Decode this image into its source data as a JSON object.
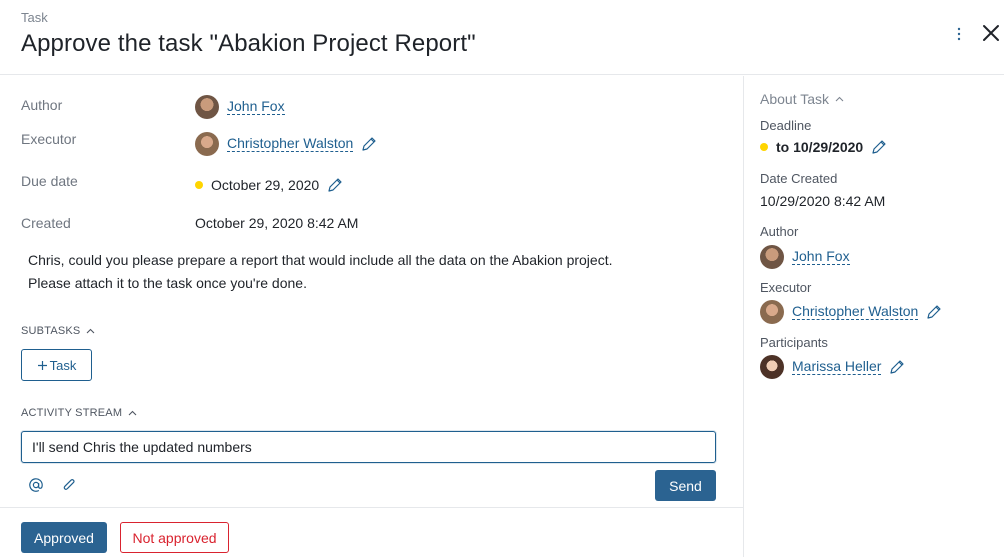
{
  "header": {
    "kind": "Task",
    "title": "Approve the task \"Abakion Project Report\""
  },
  "details": {
    "author_label": "Author",
    "author_name": "John Fox",
    "executor_label": "Executor",
    "executor_name": "Christopher Walston",
    "due_label": "Due date",
    "due_value": "October 29, 2020",
    "created_label": "Created",
    "created_value": "October 29, 2020 8:42 AM"
  },
  "description": {
    "line1": "Chris, could you please prepare a report that would include all the data on the Abakion project.",
    "line2": "Please attach it to the task once you're done."
  },
  "subtasks": {
    "title": "SUBTASKS",
    "add_label": "Task"
  },
  "activity": {
    "title": "ACTIVITY STREAM",
    "input_value": "I'll send Chris the updated numbers",
    "send_label": "Send"
  },
  "actions": {
    "approved_label": "Approved",
    "not_approved_label": "Not approved"
  },
  "sidebar": {
    "title": "About Task",
    "deadline_label": "Deadline",
    "deadline_value": "to 10/29/2020",
    "date_created_label": "Date Created",
    "date_created_value": "10/29/2020 8:42 AM",
    "author_label": "Author",
    "author_name": "John Fox",
    "executor_label": "Executor",
    "executor_name": "Christopher Walston",
    "participants_label": "Participants",
    "participant_name": "Marissa Heller"
  },
  "colors": {
    "accent": "#2b6391",
    "link": "#1f5f8f",
    "danger": "#d9232f",
    "deadline_dot": "#ffd500"
  }
}
